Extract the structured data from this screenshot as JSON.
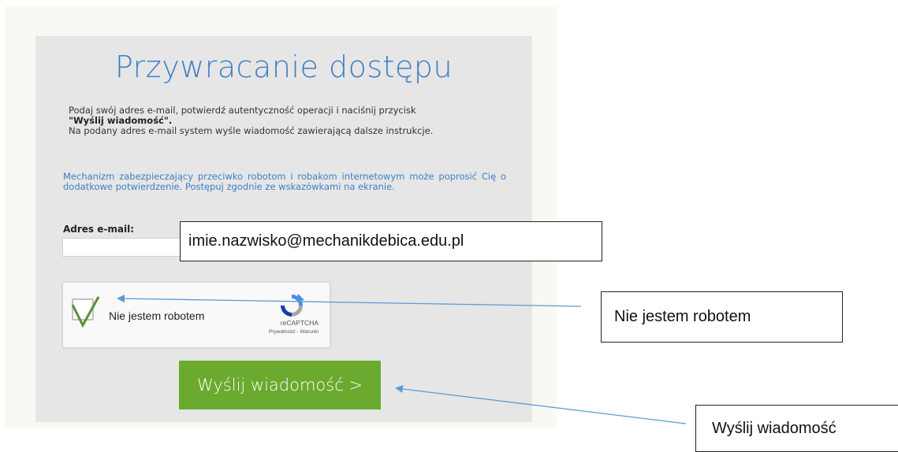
{
  "form": {
    "title": "Przywracanie dostępu",
    "instructions_line1": "Podaj swój adres e-mail, potwierdź autentyczność operacji i naciśnij przycisk",
    "instructions_bold": "\"Wyślij wiadomość\".",
    "instructions_line2": "Na podany adres e-mail system wyśle wiadomość zawierającą dalsze instrukcje.",
    "robot_info": "Mechanizm zabezpieczający przeciwko robotom i robakom internetowym może poprosić Cię o dodatkowe potwierdzenie. Postępuj zgodnie ze wskazówkami na ekranie.",
    "email_label": "Adres e-mail:",
    "email_value": "",
    "send_label": "Wyślij wiadomość >"
  },
  "recaptcha": {
    "label": "Nie jestem robotem",
    "brand": "reCAPTCHA",
    "links": "Prywatność - Warunki",
    "checked": true
  },
  "callouts": {
    "email": "imie.nazwisko@mechanikdebica.edu.pl",
    "robot": "Nie jestem robotem",
    "send": "Wyślij wiadomość"
  },
  "colors": {
    "title": "#3d7fc4",
    "button": "#6aaa2e",
    "checkmark": "#5a8f3a",
    "arrow": "#5b9bd5"
  }
}
